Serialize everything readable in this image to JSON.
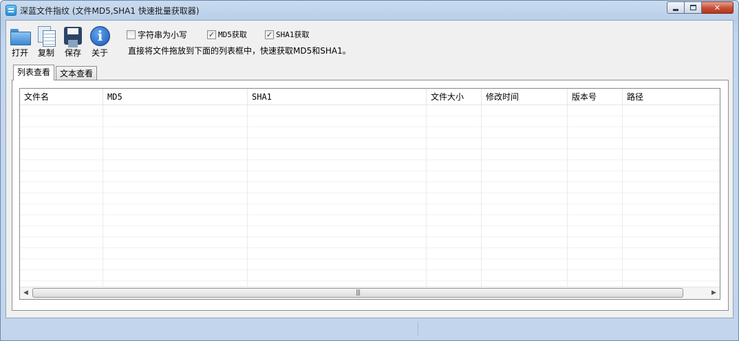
{
  "window": {
    "title": "深蓝文件指纹 (文件MD5,SHA1 快速批量获取器)",
    "controls": {
      "minimize": "",
      "maximize": "",
      "close": "✕"
    }
  },
  "toolbar": {
    "open": "打开",
    "copy": "复制",
    "save": "保存",
    "about": "关于"
  },
  "options": {
    "lowercase": {
      "label": "字符串为小写",
      "checked": false
    },
    "md5": {
      "label": "MD5获取",
      "checked": true
    },
    "sha1": {
      "label": "SHA1获取",
      "checked": true
    }
  },
  "hint": "直接将文件拖放到下面的列表框中，快速获取MD5和SHA1。",
  "tabs": [
    {
      "label": "列表查看",
      "active": true
    },
    {
      "label": "文本查看",
      "active": false
    }
  ],
  "list": {
    "columns": [
      "文件名",
      "MD5",
      "SHA1",
      "文件大小",
      "修改时间",
      "版本号",
      "路径"
    ],
    "rows": []
  },
  "scrollbar": {
    "grip": "|||"
  },
  "colors": {
    "window_frame": "#c2d5ec",
    "close_button": "#c64f36",
    "client": "#f0f0f0"
  }
}
